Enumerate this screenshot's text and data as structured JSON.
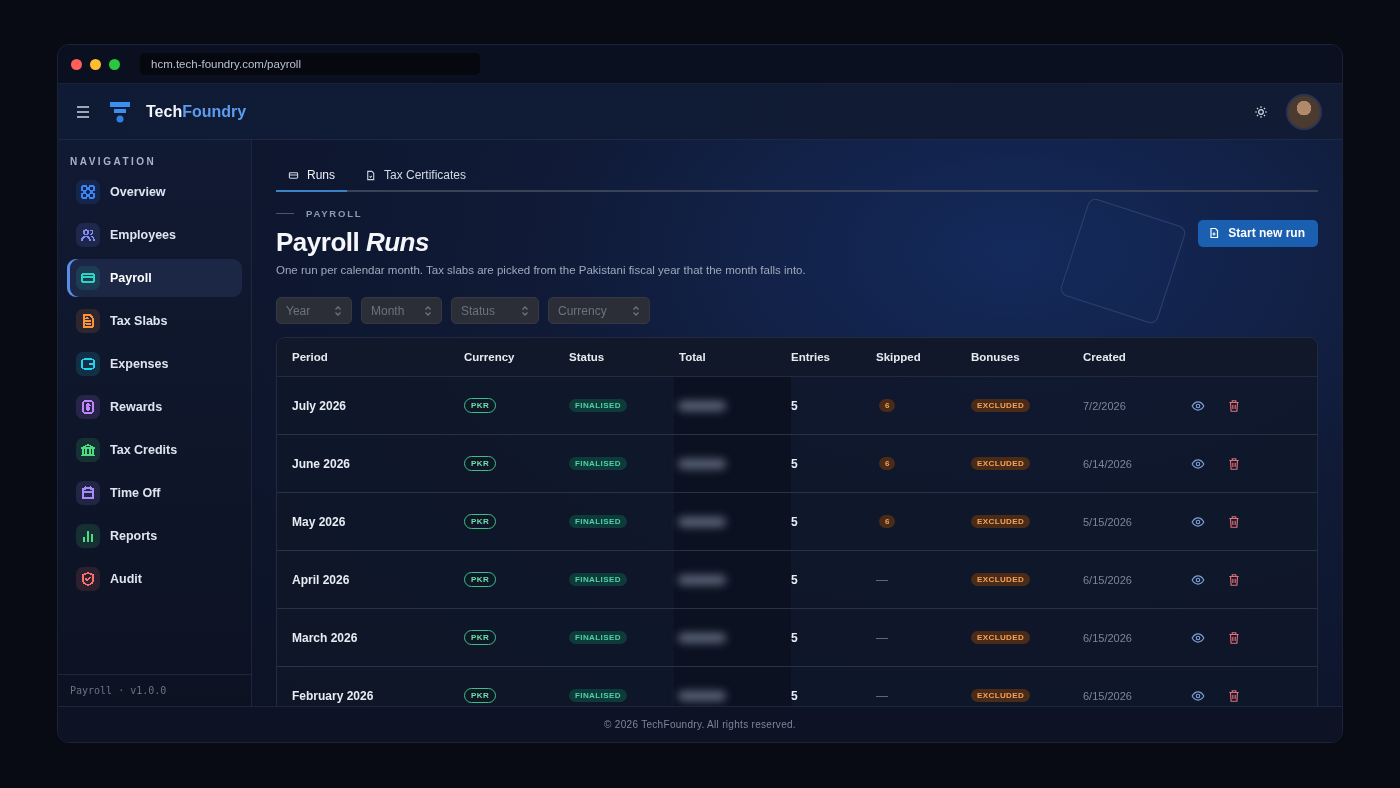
{
  "browser": {
    "url": "hcm.tech-foundry.com/payroll"
  },
  "header": {
    "brand_parts": [
      "Tech",
      "Foundry"
    ]
  },
  "sidebar": {
    "section": "NAVIGATION",
    "items": [
      {
        "label": "Overview",
        "selected": false,
        "color": "#3b82f6"
      },
      {
        "label": "Employees",
        "selected": false,
        "color": "#818cf8"
      },
      {
        "label": "Payroll",
        "selected": true,
        "color": "#2dd4bf"
      },
      {
        "label": "Tax Slabs",
        "selected": false,
        "color": "#fb923c"
      },
      {
        "label": "Expenses",
        "selected": false,
        "color": "#22d3ee"
      },
      {
        "label": "Rewards",
        "selected": false,
        "color": "#c084fc"
      },
      {
        "label": "Tax Credits",
        "selected": false,
        "color": "#4ade80"
      },
      {
        "label": "Time Off",
        "selected": false,
        "color": "#a78bfa"
      },
      {
        "label": "Reports",
        "selected": false,
        "color": "#4ade80"
      },
      {
        "label": "Audit",
        "selected": false,
        "color": "#f87171"
      }
    ],
    "version": "Payroll · v1.0.0"
  },
  "tabs": [
    {
      "label": "Runs",
      "selected": true
    },
    {
      "label": "Tax Certificates",
      "selected": false
    }
  ],
  "eyebrow": "PAYROLL",
  "title": "Payroll *Runs*",
  "subtitle": "One run per calendar month. Tax slabs are picked from the Pakistani fiscal year that the month falls into.",
  "primary_button": "Start new run",
  "filters": [
    {
      "placeholder": "Year"
    },
    {
      "placeholder": "Month"
    },
    {
      "placeholder": "Status"
    },
    {
      "placeholder": "Currency"
    }
  ],
  "table": {
    "columns": [
      "Period",
      "Currency",
      "Status",
      "Total",
      "Entries",
      "Skipped",
      "Bonuses",
      "Created"
    ],
    "rows": [
      {
        "period": "July 2026",
        "currency": "PKR",
        "status": "FINALISED",
        "entries": "5",
        "skipped": "6",
        "bonuses": "EXCLUDED",
        "created": "7/2/2026"
      },
      {
        "period": "June 2026",
        "currency": "PKR",
        "status": "FINALISED",
        "entries": "5",
        "skipped": "6",
        "bonuses": "EXCLUDED",
        "created": "6/14/2026"
      },
      {
        "period": "May 2026",
        "currency": "PKR",
        "status": "FINALISED",
        "entries": "5",
        "skipped": "6",
        "bonuses": "EXCLUDED",
        "created": "5/15/2026"
      },
      {
        "period": "April 2026",
        "currency": "PKR",
        "status": "FINALISED",
        "entries": "5",
        "skipped": "—",
        "bonuses": "EXCLUDED",
        "created": "6/15/2026"
      },
      {
        "period": "March 2026",
        "currency": "PKR",
        "status": "FINALISED",
        "entries": "5",
        "skipped": "—",
        "bonuses": "EXCLUDED",
        "created": "6/15/2026"
      },
      {
        "period": "February 2026",
        "currency": "PKR",
        "status": "FINALISED",
        "entries": "5",
        "skipped": "—",
        "bonuses": "EXCLUDED",
        "created": "6/15/2026"
      }
    ]
  },
  "footer": "© 2026 TechFoundry. All rights reserved."
}
